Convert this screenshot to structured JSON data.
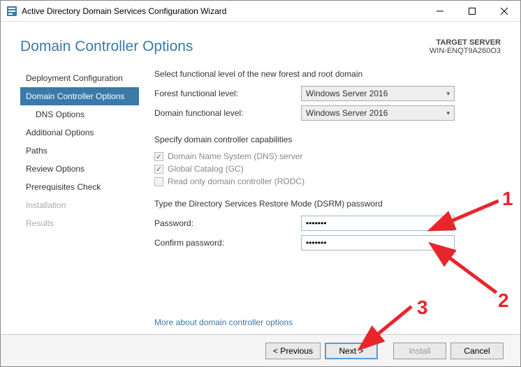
{
  "titlebar": {
    "title": "Active Directory Domain Services Configuration Wizard"
  },
  "header": {
    "title": "Domain Controller Options",
    "target_label": "TARGET SERVER",
    "target_value": "WIN-ENQT9A260O3"
  },
  "sidebar": {
    "items": [
      {
        "label": "Deployment Configuration"
      },
      {
        "label": "Domain Controller Options"
      },
      {
        "label": "DNS Options"
      },
      {
        "label": "Additional Options"
      },
      {
        "label": "Paths"
      },
      {
        "label": "Review Options"
      },
      {
        "label": "Prerequisites Check"
      },
      {
        "label": "Installation"
      },
      {
        "label": "Results"
      }
    ]
  },
  "content": {
    "func_label": "Select functional level of the new forest and root domain",
    "forest_label": "Forest functional level:",
    "forest_value": "Windows Server 2016",
    "domain_label": "Domain functional level:",
    "domain_value": "Windows Server 2016",
    "caps_label": "Specify domain controller capabilities",
    "dns_label": "Domain Name System (DNS) server",
    "gc_label": "Global Catalog (GC)",
    "rodc_label": "Read only domain controller (RODC)",
    "dsrm_label": "Type the Directory Services Restore Mode (DSRM) password",
    "password_label": "Password:",
    "password_value": "•••••••",
    "confirm_label": "Confirm password:",
    "confirm_value": "•••••••",
    "more_link": "More about domain controller options"
  },
  "footer": {
    "previous": "< Previous",
    "next": "Next >",
    "install": "Install",
    "cancel": "Cancel"
  },
  "annotations": {
    "n1": "1",
    "n2": "2",
    "n3": "3"
  }
}
